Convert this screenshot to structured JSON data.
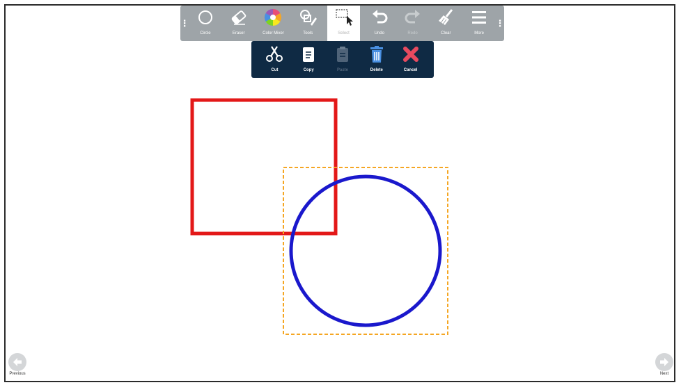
{
  "toolbar": {
    "tools": [
      {
        "label": "Circle",
        "icon": "circle-icon"
      },
      {
        "label": "Eraser",
        "icon": "eraser-icon"
      },
      {
        "label": "Color Mixer",
        "icon": "color-wheel-icon"
      },
      {
        "label": "Tools",
        "icon": "shapes-pen-icon"
      },
      {
        "label": "Select",
        "icon": "select-pointer-icon"
      },
      {
        "label": "Undo",
        "icon": "undo-icon"
      },
      {
        "label": "Redo",
        "icon": "redo-icon"
      },
      {
        "label": "Clear",
        "icon": "broom-icon"
      },
      {
        "label": "More",
        "icon": "menu-icon"
      }
    ],
    "grip_glyph": "⋮"
  },
  "submenu": {
    "items": [
      {
        "label": "Cut",
        "icon": "scissors-icon"
      },
      {
        "label": "Copy",
        "icon": "copy-icon"
      },
      {
        "label": "Paste",
        "icon": "paste-icon"
      },
      {
        "label": "Delete",
        "icon": "trash-icon"
      },
      {
        "label": "Cancel",
        "icon": "cancel-x-icon"
      }
    ]
  },
  "canvas": {
    "shapes": [
      {
        "type": "square",
        "color": "#e31818"
      },
      {
        "type": "circle",
        "color": "#1a18cc"
      },
      {
        "type": "selection-box",
        "color": "#f5a623"
      }
    ]
  },
  "nav": {
    "previous_label": "Previous",
    "next_label": "Next"
  },
  "colors": {
    "toolbar_bg": "#9ea4a8",
    "submenu_bg": "#0f2a44",
    "active_tool_bg": "#ffffff"
  }
}
